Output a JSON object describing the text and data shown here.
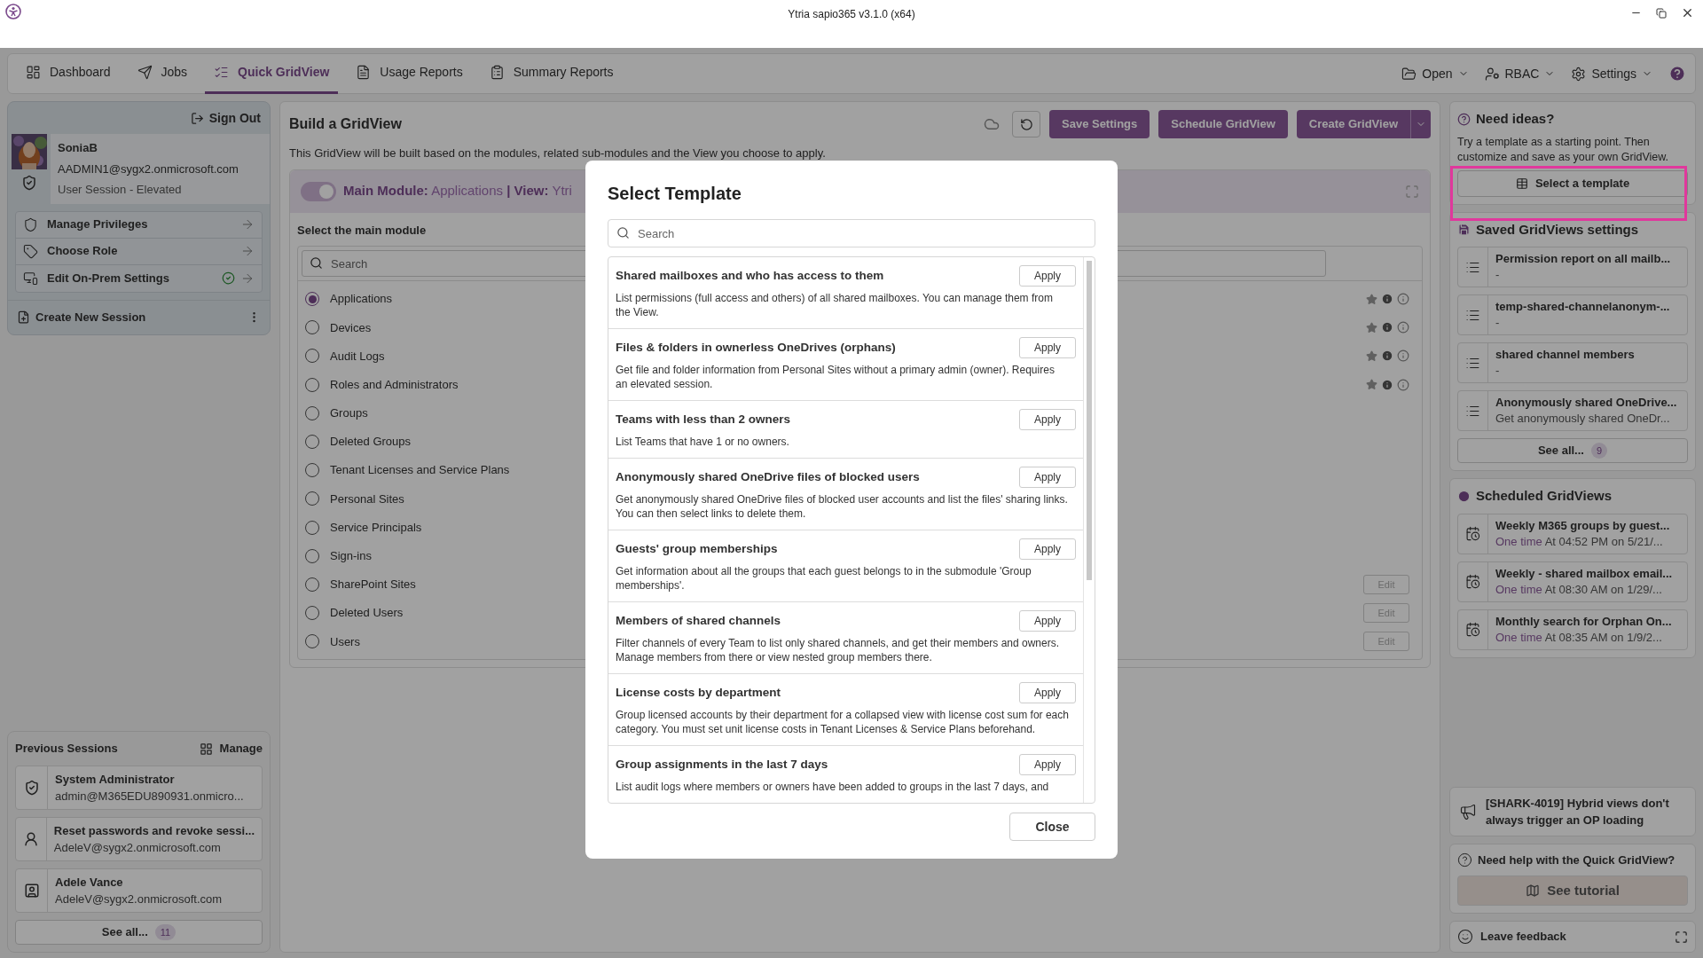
{
  "window": {
    "title": "Ytria sapio365 v3.1.0 (x64)"
  },
  "nav": {
    "tabs": [
      {
        "label": "Dashboard",
        "selected": false
      },
      {
        "label": "Jobs",
        "selected": false
      },
      {
        "label": "Quick GridView",
        "selected": true
      },
      {
        "label": "Usage Reports",
        "selected": false
      },
      {
        "label": "Summary Reports",
        "selected": false
      }
    ],
    "menus": [
      {
        "label": "Open"
      },
      {
        "label": "RBAC"
      },
      {
        "label": "Settings"
      }
    ]
  },
  "session": {
    "sign_out": "Sign Out",
    "user": "SoniaB",
    "email": "AADMIN1@sygx2.onmicrosoft.com",
    "session_type": "User Session - Elevated",
    "actions": [
      {
        "label": "Manage Privileges",
        "verified": false
      },
      {
        "label": "Choose Role",
        "verified": false
      },
      {
        "label": "Edit On-Prem Settings",
        "verified": true
      }
    ],
    "create": "Create New Session"
  },
  "previous_sessions": {
    "title": "Previous Sessions",
    "manage": "Manage",
    "items": [
      {
        "name": "System Administrator",
        "detail": "admin@M365EDU890931.onmicro..."
      },
      {
        "name": "Reset passwords and revoke sessi...",
        "detail": "AdeleV@sygx2.onmicrosoft.com"
      },
      {
        "name": "Adele Vance",
        "detail": "AdeleV@sygx2.onmicrosoft.com"
      }
    ],
    "see_all": "See all...",
    "count": "11"
  },
  "builder": {
    "title": "Build a GridView",
    "buttons": [
      "Save Settings",
      "Schedule GridView",
      "Create GridView"
    ],
    "description": "This GridView will be built based on the modules, related sub-modules and the View you choose to apply.",
    "module_bar": {
      "on": true,
      "label": "Main Module:",
      "module": "Applications",
      "view_label": "| View:",
      "view": "Ytri"
    },
    "section_title": "Select the main module",
    "search_placeholder": "Search",
    "modules": [
      {
        "label": "Applications",
        "selected": true,
        "kind": "info"
      },
      {
        "label": "Devices",
        "selected": false,
        "kind": "info"
      },
      {
        "label": "Audit Logs",
        "selected": false,
        "kind": "info"
      },
      {
        "label": "Roles and Administrators",
        "selected": false,
        "kind": "info"
      },
      {
        "label": "Groups",
        "selected": false,
        "kind": "plain"
      },
      {
        "label": "Deleted Groups",
        "selected": false,
        "kind": "plain"
      },
      {
        "label": "Tenant Licenses and Service Plans",
        "selected": false,
        "kind": "plain"
      },
      {
        "label": "Personal Sites",
        "selected": false,
        "kind": "plain"
      },
      {
        "label": "Service Principals",
        "selected": false,
        "kind": "plain"
      },
      {
        "label": "Sign-ins",
        "selected": false,
        "kind": "plain"
      },
      {
        "label": "SharePoint Sites",
        "selected": false,
        "kind": "edit",
        "action": "Edit"
      },
      {
        "label": "Deleted Users",
        "selected": false,
        "kind": "edit",
        "action": "Edit"
      },
      {
        "label": "Users",
        "selected": false,
        "kind": "edit",
        "action": "Edit"
      }
    ]
  },
  "ideas": {
    "title": "Need ideas?",
    "text": "Try a template as a starting point. Then customize and save as your own GridView.",
    "button": "Select a template"
  },
  "saved": {
    "title": "Saved GridViews settings",
    "items": [
      {
        "name": "Permission report on all mailb...",
        "detail": "-"
      },
      {
        "name": "temp-shared-channelanonym-...",
        "detail": "-"
      },
      {
        "name": "shared channel members",
        "detail": "-"
      },
      {
        "name": "Anonymously shared OneDrive...",
        "detail": "Get anonymously shared OneDr..."
      }
    ],
    "see_all": "See all...",
    "count": "9"
  },
  "scheduled": {
    "title": "Scheduled GridViews",
    "items": [
      {
        "name": "Weekly M365 groups by guest...",
        "frequency": "One time",
        "detail": "At 04:52 PM on 5/21/..."
      },
      {
        "name": "Weekly - shared mailbox email...",
        "frequency": "One time",
        "detail": "At 08:30 AM on 1/29/..."
      },
      {
        "name": "Monthly search for Orphan On...",
        "frequency": "One time",
        "detail": "At 08:35 AM on 1/9/2..."
      }
    ]
  },
  "notice": {
    "text": "[SHARK-4019] Hybrid views don't always trigger an OP loading"
  },
  "help": {
    "text": "Need help with the Quick GridView?",
    "button": "See tutorial"
  },
  "feedback": {
    "label": "Leave feedback"
  },
  "modal": {
    "title": "Select Template",
    "search_placeholder": "Search",
    "close": "Close",
    "templates": [
      {
        "title": "Shared mailboxes and who has access to them",
        "description": "List permissions (full access and others) of all shared mailboxes. You can manage them from the View.",
        "apply": "Apply"
      },
      {
        "title": "Files & folders in ownerless OneDrives (orphans)",
        "description": "Get file and folder information from Personal Sites without a primary admin (owner). Requires an elevated session.",
        "apply": "Apply"
      },
      {
        "title": "Teams with less than 2 owners",
        "description": "List Teams that have 1 or no owners.",
        "apply": "Apply"
      },
      {
        "title": "Anonymously shared OneDrive files of blocked users",
        "description": "Get anonymously shared OneDrive files of blocked user accounts and list the files' sharing links. You can then select links to delete them.",
        "apply": "Apply"
      },
      {
        "title": "Guests' group memberships",
        "description": "Get information about all the groups that each guest belongs to in the submodule 'Group memberships'.",
        "apply": "Apply"
      },
      {
        "title": "Members of shared channels",
        "description": "Filter channels of every Team to list only shared channels, and get their members and owners. Manage members from there or view nested group members there.",
        "apply": "Apply"
      },
      {
        "title": "License costs by department",
        "description": "Group licensed accounts by their department for a collapsed view with license cost sum for each category. You must set unit license costs in Tenant Licenses & Service Plans beforehand.",
        "apply": "Apply"
      },
      {
        "title": "Group assignments in the last 7 days",
        "description": "List audit logs where members or owners have been added to groups in the last 7 days, and",
        "apply": "Apply"
      }
    ]
  }
}
